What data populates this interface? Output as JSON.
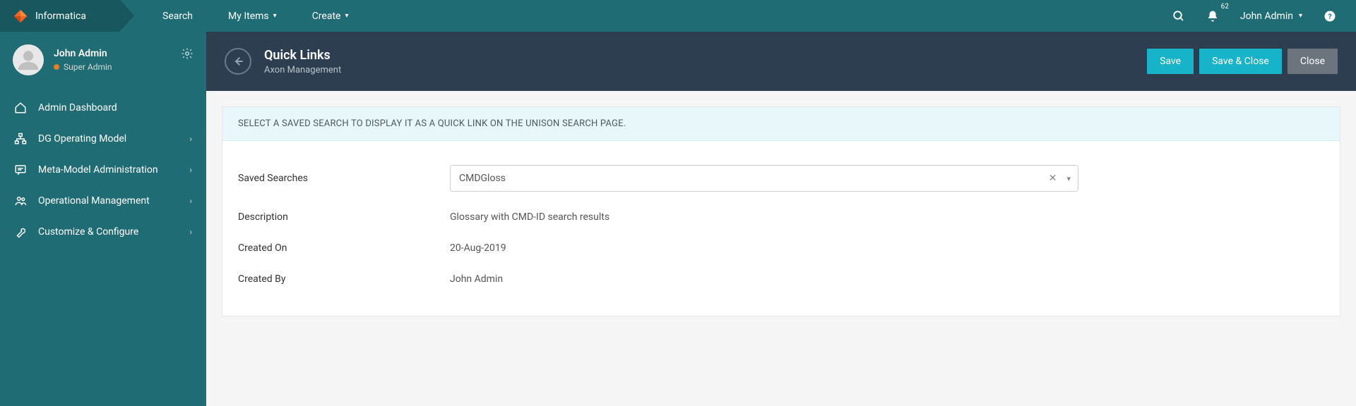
{
  "brand": "Informatica",
  "nav": {
    "search": "Search",
    "my_items": "My Items",
    "create": "Create"
  },
  "notifications": {
    "count": "62"
  },
  "user": {
    "name": "John Admin",
    "role": "Super Admin"
  },
  "sidebar": {
    "items": [
      {
        "label": "Admin Dashboard",
        "has_children": false
      },
      {
        "label": "DG Operating Model",
        "has_children": true
      },
      {
        "label": "Meta-Model Administration",
        "has_children": true
      },
      {
        "label": "Operational Management",
        "has_children": true
      },
      {
        "label": "Customize & Configure",
        "has_children": true
      }
    ]
  },
  "page": {
    "title": "Quick Links",
    "subtitle": "Axon Management",
    "actions": {
      "save": "Save",
      "save_close": "Save & Close",
      "close": "Close"
    }
  },
  "banner": "SELECT A SAVED SEARCH TO DISPLAY IT AS A QUICK LINK ON THE UNISON SEARCH PAGE.",
  "form": {
    "saved_searches": {
      "label": "Saved Searches",
      "value": "CMDGloss"
    },
    "description": {
      "label": "Description",
      "value": "Glossary with CMD-ID search results"
    },
    "created_on": {
      "label": "Created On",
      "value": "20-Aug-2019"
    },
    "created_by": {
      "label": "Created By",
      "value": "John Admin"
    }
  }
}
